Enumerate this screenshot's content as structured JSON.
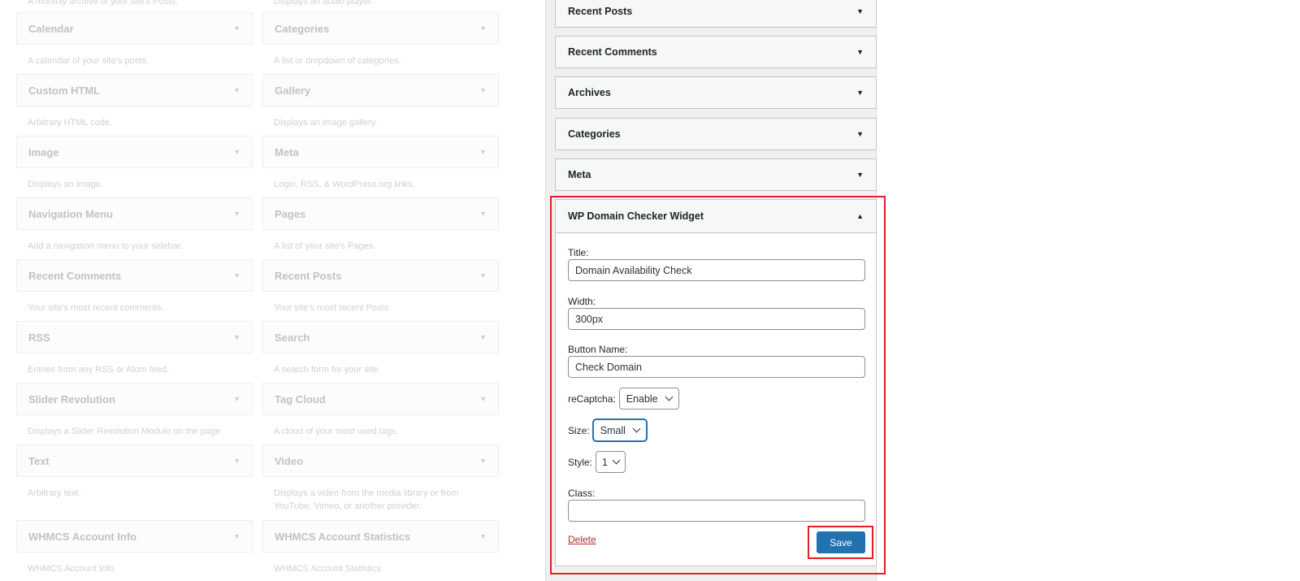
{
  "available_widgets": {
    "top_fragment_left": "A monthly archive of your site's Posts.",
    "top_fragment_right": "Displays an audio player.",
    "items": [
      {
        "title": "Calendar",
        "desc": "A calendar of your site's posts."
      },
      {
        "title": "Categories",
        "desc": "A list or dropdown of categories."
      },
      {
        "title": "Custom HTML",
        "desc": "Arbitrary HTML code."
      },
      {
        "title": "Gallery",
        "desc": "Displays an image gallery."
      },
      {
        "title": "Image",
        "desc": "Displays an image."
      },
      {
        "title": "Meta",
        "desc": "Login, RSS, & WordPress.org links."
      },
      {
        "title": "Navigation Menu",
        "desc": "Add a navigation menu to your sidebar."
      },
      {
        "title": "Pages",
        "desc": "A list of your site's Pages."
      },
      {
        "title": "Recent Comments",
        "desc": "Your site's most recent comments."
      },
      {
        "title": "Recent Posts",
        "desc": "Your site's most recent Posts."
      },
      {
        "title": "RSS",
        "desc": "Entries from any RSS or Atom feed."
      },
      {
        "title": "Search",
        "desc": "A search form for your site."
      },
      {
        "title": "Slider Revolution",
        "desc": "Displays a Slider Revolution Module on the page"
      },
      {
        "title": "Tag Cloud",
        "desc": "A cloud of your most used tags."
      },
      {
        "title": "Text",
        "desc": "Arbitrary text."
      },
      {
        "title": "Video",
        "desc": "Displays a video from the media library or from YouTube, Vimeo, or another provider."
      },
      {
        "title": "WHMCS Account Info",
        "desc": "WHMCS Account Info"
      },
      {
        "title": "WHMCS Account Statistics",
        "desc": "WHMCS Account Statistics"
      }
    ]
  },
  "sidebar": {
    "widgets": [
      "Recent Posts",
      "Recent Comments",
      "Archives",
      "Categories",
      "Meta"
    ],
    "expanded_widget": {
      "title": "WP Domain Checker Widget",
      "title_label": "Title:",
      "title_value": "Domain Availability Check",
      "width_label": "Width:",
      "width_value": "300px",
      "button_name_label": "Button Name:",
      "button_name_value": "Check Domain",
      "recaptcha_label": "reCaptcha:",
      "recaptcha_value": "Enable",
      "size_label": "Size:",
      "size_value": "Small",
      "style_label": "Style:",
      "style_value": "1",
      "class_label": "Class:",
      "class_value": "",
      "delete_label": "Delete",
      "save_label": "Save"
    }
  },
  "icons": {
    "collapsed": "triangle-down",
    "expanded": "triangle-up"
  },
  "colors": {
    "primary_button": "#2271b1",
    "highlight": "#e41e26",
    "delete": "#b32d2e"
  }
}
